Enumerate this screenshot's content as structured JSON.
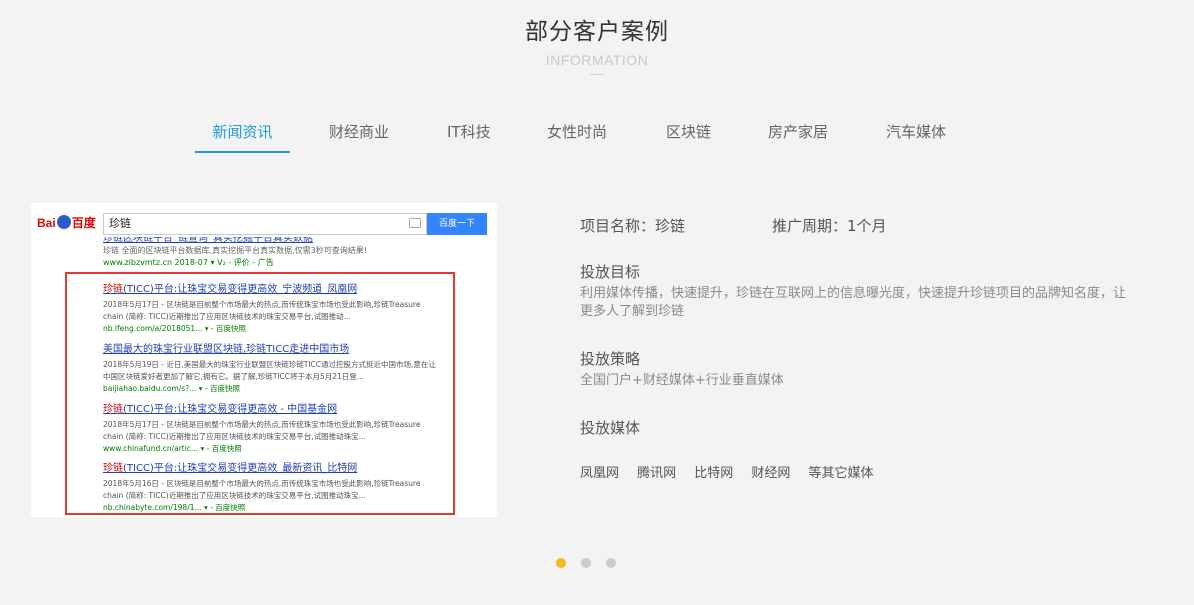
{
  "heading": {
    "title": "部分客户案例",
    "subtitle": "INFORMATION"
  },
  "tabs": [
    "新闻资讯",
    "财经商业",
    "IT科技",
    "女性时尚",
    "区块链",
    "房产家居",
    "汽车媒体"
  ],
  "screenshot": {
    "logo": "Bai百度",
    "query": "珍链",
    "search_button": "百度一下",
    "top_line_title": "珍链区块链平台_链查询_真实挖掘平台真实数据",
    "top_line_desc": "珍链 全面的区块链平台数据库,真实挖掘平台真实数据,仅需3秒可查询结果!",
    "top_line_url": "www.zibzvmtz.cn  2018-07  ▾  V₂  - 评价 - 广告",
    "results": [
      {
        "title_pre": "珍链",
        "title": "(TICC)平台:让珠宝交易变得更高效_宁波频道_凤凰网",
        "desc": "2018年5月17日 - 区块链是目前整个市场最大的热点,而传统珠宝市场也受此影响,珍链Treasure chain (简称: TICC)近期推出了应用区块链技术的珠宝交易平台,试图推动...",
        "url": "nb.ifeng.com/a/2018051...  ▾  - 百度快照"
      },
      {
        "title_pre": "",
        "title": "美国最大的珠宝行业联盟区块链,珍链TICC走进中国市场",
        "desc": "2018年5月19日 - 近日,美国最大的珠宝行业联盟区块链珍链TICC通过控股方式挺近中国市场,意在让中国区块链爱好者更加了解它,拥有它。据了解,珍链TICC将于本月5月21日登...",
        "url": "baijiahao.baidu.com/s?...  ▾  - 百度快照"
      },
      {
        "title_pre": "珍链",
        "title": "(TICC)平台:让珠宝交易变得更高效 - 中国基金网",
        "desc": "2018年5月17日 - 区块链是目前整个市场最大的热点,而传统珠宝市场也受此影响,珍链Treasure chain (简称: TICC)近期推出了应用区块链技术的珠宝交易平台,试图推动珠宝...",
        "url": "www.chinafund.cn/artic...  ▾  - 百度快照"
      },
      {
        "title_pre": "珍链",
        "title": "(TICC)平台:让珠宝交易变得更高效_最新资讯_比特网",
        "desc": "2018年5月16日 - 区块链是目前整个市场最大的热点,而传统珠宝市场也受此影响,珍链Treasure chain (简称: TICC)近期推出了应用区块链技术的珠宝交易平台,试图推动珠宝...",
        "url": "nb.chinabyte.com/198/1...  ▾  - 百度快照"
      }
    ]
  },
  "info": {
    "project_name": "项目名称：珍链",
    "period": "推广周期：1个月",
    "goal_head": "投放目标",
    "goal_text": "利用媒体传播，快速提升，珍链在互联网上的信息曝光度，快速提升珍链项目的品牌知名度，让更多人了解到珍链",
    "strategy_head": "投放策略",
    "strategy_text": "全国门户+财经媒体+行业垂直媒体",
    "media_head": "投放媒体",
    "media": [
      "凤凰网",
      "腾讯网",
      "比特网",
      "财经网",
      "等其它媒体"
    ]
  },
  "carousel": {
    "count": 3,
    "active": 1
  },
  "colors": {
    "accent": "#1d9ad6",
    "dot_active": "#f5b914",
    "highlight": "#e53935"
  }
}
